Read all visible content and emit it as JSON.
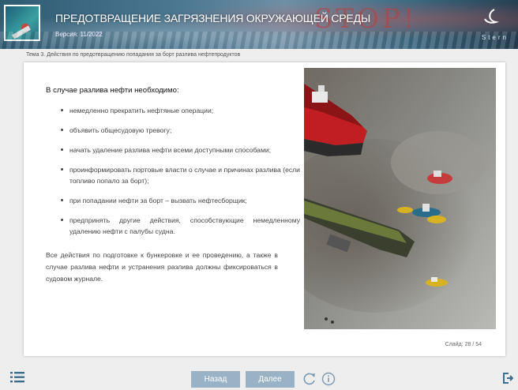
{
  "header": {
    "title": "ПРЕДОТВРАЩЕНИЕ ЗАГРЯЗНЕНИЯ ОКРУЖАЮЩЕЙ СРЕДЫ",
    "version": "Версия: 11/2022",
    "banner_word": "STOP!",
    "logo_text": "Stern"
  },
  "breadcrumb": "Тема 3. Действия по предотвращению попадания за борт разлива нефтепродуктов",
  "content": {
    "heading": "В случае разлива нефти необходимо:",
    "items": [
      "немедленно прекратить нефтяные операции;",
      "объявить общесудовую тревогу;",
      "начать удаление разлива нефти всеми доступными способами;",
      "проинформировать портовые власти о случае и причинах разлива (если топливо попало за борт);",
      "при попадании нефти за борт – вызвать нефтесборщик;",
      "предпринять другие действия, способствующие немедленному удалению нефти с палубы судна."
    ],
    "note": "Все действия по подготовке к бункеровке и ее проведению, а также в случае разлива нефти и устранения разлива должны фиксироваться в судовом журнале."
  },
  "slide_counter": "Слайд: 28 / 54",
  "nav": {
    "back_label": "Назад",
    "next_label": "Далее"
  },
  "colors": {
    "button": "#9ab2c6",
    "header": "#4c7892",
    "icons": "#3e6e8e"
  }
}
